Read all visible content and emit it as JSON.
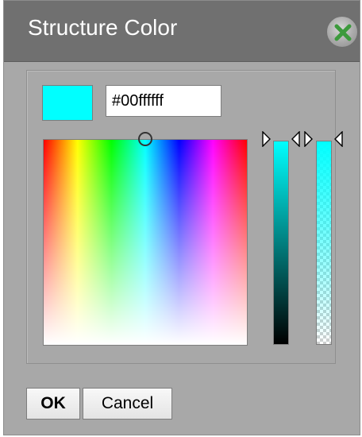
{
  "dialog": {
    "title": "Structure Color",
    "close_icon": "close-x-icon"
  },
  "color": {
    "swatch_color": "#00ffff",
    "hex_value": "#00ffffff",
    "hue_saturation_cursor_icon": "circle-cursor-icon",
    "value_slider_level": 1.0,
    "alpha_slider_level": 1.0,
    "arrow_icon": "triangle-pointer-icon"
  },
  "buttons": {
    "ok_label": "OK",
    "cancel_label": "Cancel"
  }
}
